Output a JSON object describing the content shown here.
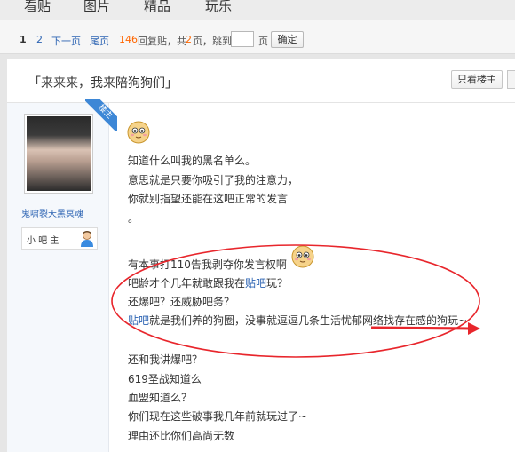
{
  "nav": {
    "tabs": [
      "看贴",
      "图片",
      "精品",
      "玩乐"
    ]
  },
  "pager": {
    "current": "1",
    "page2": "2",
    "next": "下一页",
    "last": "尾页",
    "reply_count": "146",
    "reply_label": "回复贴，共",
    "total_pages": "2",
    "pages_suffix": "页，跳到",
    "page_unit": "页",
    "confirm": "确定"
  },
  "thread": {
    "title": "「来来来，我来陪狗狗们」",
    "only_author": "只看楼主"
  },
  "author": {
    "name": "鬼啸裂天黑冥魂",
    "role": "小 吧 主",
    "floor_badge": "楼主"
  },
  "post": {
    "p1": [
      "知道什么叫我的黑名单么。",
      "意思就是只要你吸引了我的注意力，",
      "你就别指望还能在这吧正常的发言",
      "。"
    ],
    "p2": {
      "l1": "有本事打110告我剥夺你发言权啊",
      "l2_a": "吧龄才个几年就敢跟我在",
      "l2_link": "贴吧",
      "l2_b": "玩？",
      "l3": "还爆吧？还威胁吧务？",
      "l4_link": "贴吧",
      "l4_b": "就是我们养的狗圈，没事就逗逗几条生活忧郁网络找存在感的狗玩~"
    },
    "p3": [
      "还和我讲爆吧？",
      "619圣战知道么",
      "血盟知道么？",
      "你们现在这些破事我几年前就玩过了~",
      "理由还比你们高尚无数"
    ]
  },
  "colors": {
    "link": "#2d64b3",
    "accent_orange": "#ff6600",
    "annotation_red": "#e8262c",
    "ribbon_blue": "#3d87d6"
  }
}
